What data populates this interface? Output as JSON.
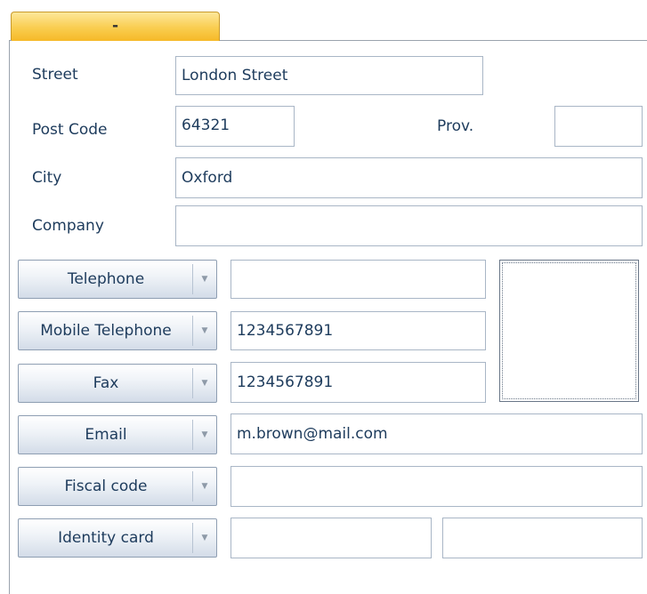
{
  "tab": {
    "label": "-"
  },
  "address": {
    "street_label": "Street",
    "street_value": "London Street",
    "postcode_label": "Post Code",
    "postcode_value": "64321",
    "prov_label": "Prov.",
    "prov_value": "",
    "city_label": "City",
    "city_value": "Oxford",
    "company_label": "Company",
    "company_value": ""
  },
  "contacts": [
    {
      "type": "Telephone",
      "value": ""
    },
    {
      "type": "Mobile Telephone",
      "value": "1234567891"
    },
    {
      "type": "Fax",
      "value": "1234567891"
    },
    {
      "type": "Email",
      "value": "m.brown@mail.com"
    },
    {
      "type": "Fiscal code",
      "value": ""
    },
    {
      "type": "Identity card",
      "value": "",
      "value2": ""
    }
  ],
  "icons": {
    "dropdown_arrow": "chevron-down-icon",
    "photo": "photo-placeholder-icon"
  },
  "colors": {
    "tab_accent": "#f9cd4f",
    "text": "#1d3b5c",
    "border": "#a9b6c6"
  }
}
